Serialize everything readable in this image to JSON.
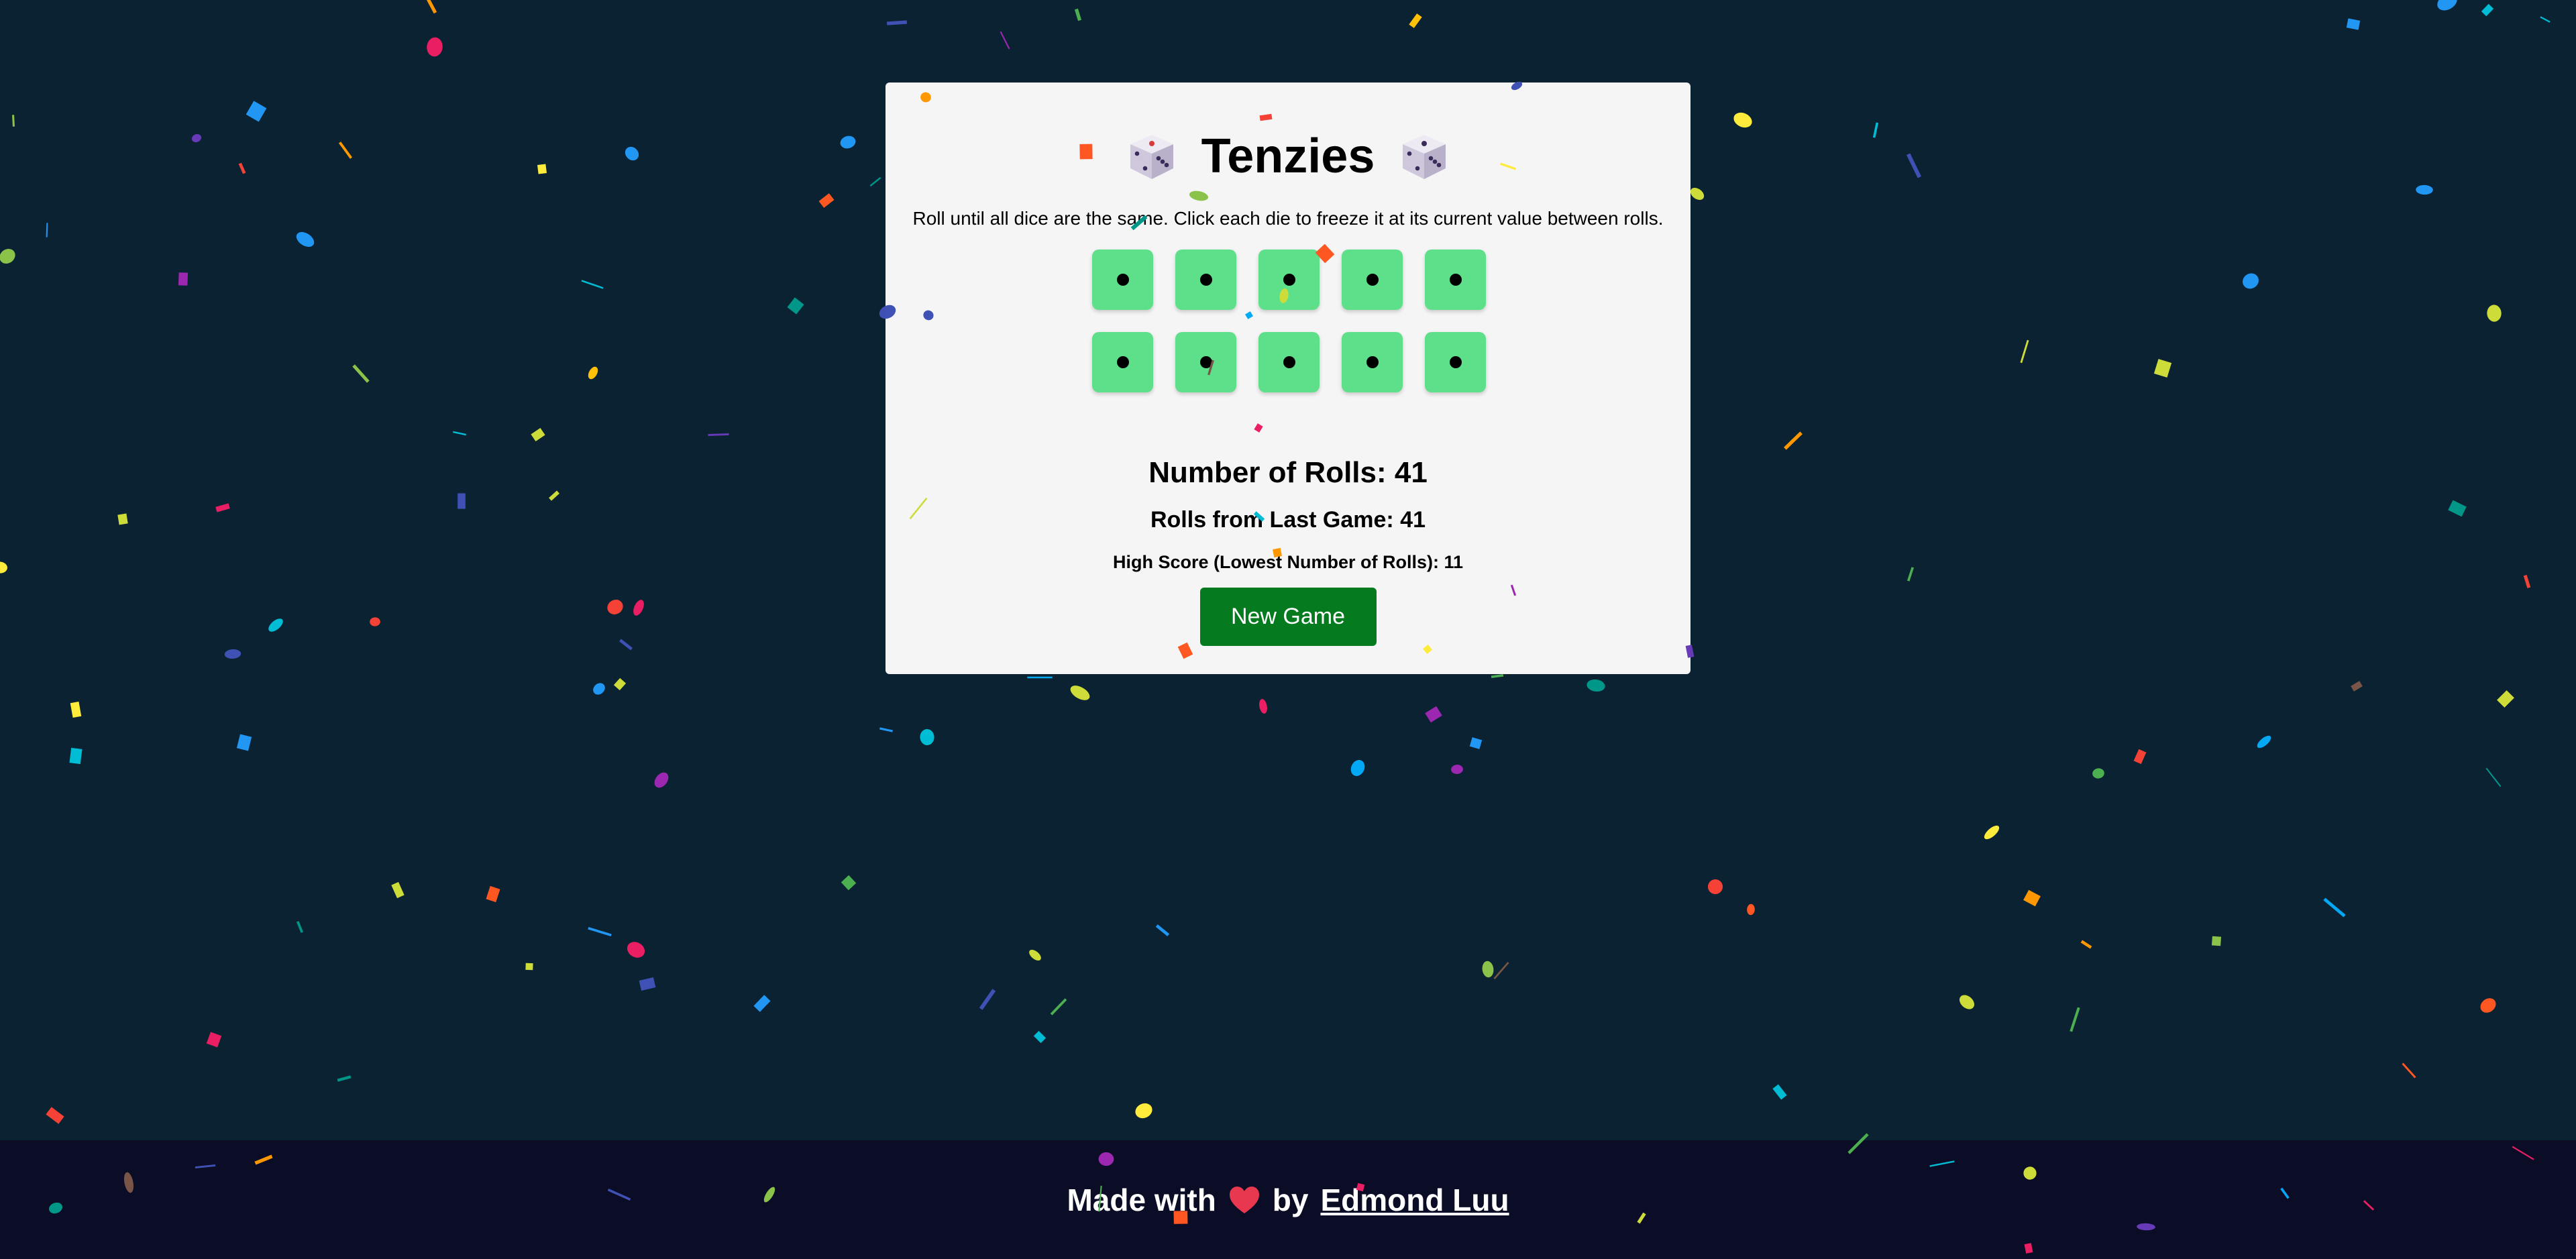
{
  "app": {
    "title": "Tenzies",
    "instructions": "Roll until all dice are the same. Click each die to freeze it at its current value between rolls."
  },
  "icons": {
    "left_title_icon": "dice-icon",
    "right_title_icon": "dice-icon",
    "footer_icon": "heart-icon"
  },
  "dice": [
    {
      "value": 1,
      "held": true
    },
    {
      "value": 1,
      "held": true
    },
    {
      "value": 1,
      "held": true
    },
    {
      "value": 1,
      "held": true
    },
    {
      "value": 1,
      "held": true
    },
    {
      "value": 1,
      "held": true
    },
    {
      "value": 1,
      "held": true
    },
    {
      "value": 1,
      "held": true
    },
    {
      "value": 1,
      "held": true
    },
    {
      "value": 1,
      "held": true
    }
  ],
  "stats": {
    "rolls_text": "Number of Rolls: 41",
    "last_game_text": "Rolls from Last Game: 41",
    "high_score_text": "High Score (Lowest Number of Rolls): 11"
  },
  "button": {
    "new_game_label": "New Game"
  },
  "footer": {
    "made_with": "Made with",
    "by": "by",
    "author": "Edmond Luu"
  },
  "colors": {
    "background": "#0b2232",
    "card": "#f5f5f5",
    "die_held": "#5ee08b",
    "button": "#057a1f",
    "footer": "#0b0c25"
  }
}
